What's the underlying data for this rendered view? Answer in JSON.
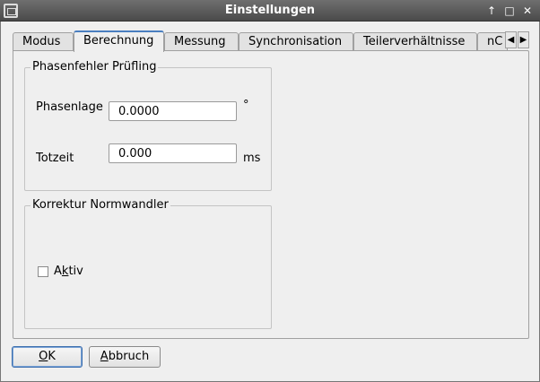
{
  "window": {
    "title": "Einstellungen",
    "controls": {
      "pin": "↑",
      "maximize": "□",
      "close": "✕"
    }
  },
  "tabs": [
    {
      "label": "Modus"
    },
    {
      "label": "Berechnung"
    },
    {
      "label": "Messung"
    },
    {
      "label": "Synchronisation"
    },
    {
      "label": "Teilerverhältnisse"
    },
    {
      "label": "nC"
    }
  ],
  "tab_scroll": {
    "left": "◀",
    "right": "▶"
  },
  "phasenfehler": {
    "title": "Phasenfehler Prüfling",
    "phasenlage_label": "Phasenlage",
    "phasenlage_value": "0.0000",
    "phasenlage_unit": "°",
    "totzeit_label": "Totzeit",
    "totzeit_value": "0.000",
    "totzeit_unit": "ms"
  },
  "korrektur": {
    "title": "Korrektur Normwandler",
    "aktiv_label_prefix": "A",
    "aktiv_label_mnemonic": "k",
    "aktiv_label_suffix": "tiv"
  },
  "buttons": {
    "ok_mnemonic": "O",
    "ok_rest": "K",
    "abbruch_mnemonic": "A",
    "abbruch_rest": "bbruch"
  }
}
